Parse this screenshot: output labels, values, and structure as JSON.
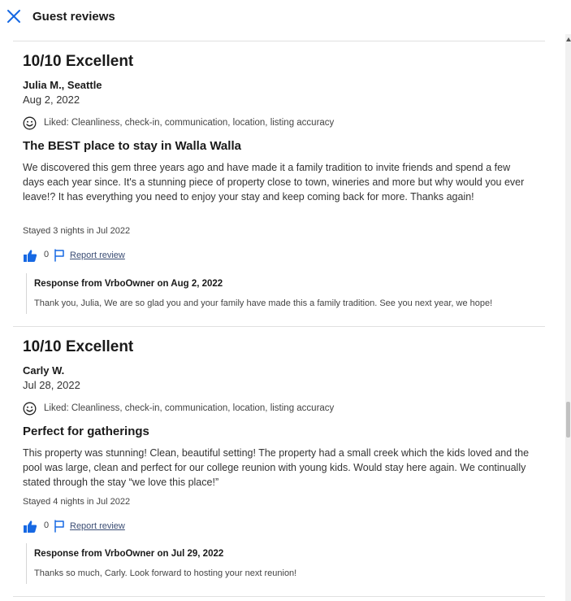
{
  "header": {
    "title": "Guest reviews"
  },
  "reviews": [
    {
      "rating": "10/10 Excellent",
      "author": "Julia M., Seattle",
      "date": "Aug 2, 2022",
      "liked": "Liked: Cleanliness, check-in, communication, location, listing accuracy",
      "title": "The BEST place to stay in Walla Walla",
      "body": "We discovered this gem three years ago and have made it a family tradition to invite friends and spend a few days each year since. It's a stunning piece of property close to town, wineries and more but why would you ever leave!? It has everything you need to enjoy your stay and keep coming back for more. Thanks again!",
      "stayed": "Stayed 3 nights in Jul 2022",
      "likes": "0",
      "report_label": "Report review",
      "response": {
        "heading": "Response from VrboOwner on Aug 2, 2022",
        "text": "Thank you, Julia, We are so glad you and your family have made this a family tradition. See you next year, we hope!"
      }
    },
    {
      "rating": "10/10 Excellent",
      "author": "Carly W.",
      "date": "Jul 28, 2022",
      "liked": "Liked: Cleanliness, check-in, communication, location, listing accuracy",
      "title": "Perfect for gatherings",
      "body": "This property was stunning! Clean, beautiful setting! The property had a small creek which the kids loved and the pool was large, clean and perfect for our college reunion with young kids. Would stay here again. We continually stated through the stay “we love this place!”",
      "stayed": "Stayed 4 nights in Jul 2022",
      "likes": "0",
      "report_label": "Report review",
      "response": {
        "heading": "Response from VrboOwner on Jul 29, 2022",
        "text": "Thanks so much, Carly. Look forward to hosting your next reunion!"
      }
    }
  ],
  "colors": {
    "accent": "#1668e3",
    "link": "#3b4d74",
    "divider": "#e0e0e0"
  },
  "icons": {
    "close": "close-icon",
    "smile": "smile-icon",
    "thumbs_up": "thumbs-up-icon",
    "flag": "flag-icon"
  }
}
